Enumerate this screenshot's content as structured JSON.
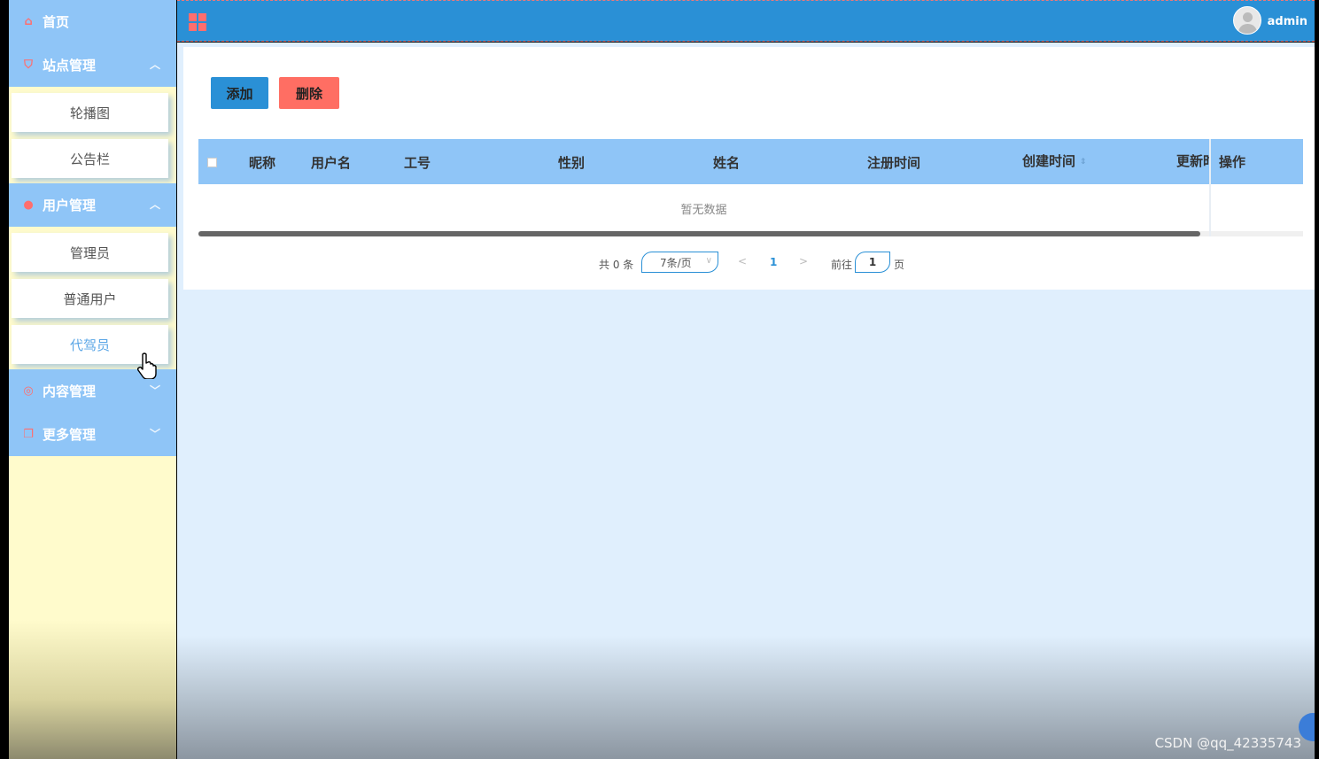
{
  "sidebar": {
    "items": [
      {
        "label": "首页",
        "icon": "home-icon",
        "type": "top"
      },
      {
        "label": "站点管理",
        "icon": "bookmark-icon",
        "type": "group",
        "expanded": true,
        "children": [
          {
            "label": "轮播图"
          },
          {
            "label": "公告栏"
          }
        ]
      },
      {
        "label": "用户管理",
        "icon": "user-icon",
        "type": "group",
        "expanded": true,
        "children": [
          {
            "label": "管理员"
          },
          {
            "label": "普通用户"
          },
          {
            "label": "代驾员",
            "active": true
          }
        ]
      },
      {
        "label": "内容管理",
        "icon": "chat-icon",
        "type": "group",
        "expanded": false
      },
      {
        "label": "更多管理",
        "icon": "copy-icon",
        "type": "group",
        "expanded": false
      }
    ]
  },
  "header": {
    "username": "admin"
  },
  "toolbar": {
    "add_label": "添加",
    "delete_label": "删除"
  },
  "table": {
    "columns": [
      "昵称",
      "用户名",
      "工号",
      "性别",
      "姓名",
      "注册时间",
      "创建时间",
      "更新时"
    ],
    "action_column": "操作",
    "empty_text": "暂无数据"
  },
  "pagination": {
    "total_text": "共 0 条",
    "page_size": "7条/页",
    "current_page": "1",
    "goto_label": "前往",
    "goto_value": "1",
    "unit_label": "页"
  },
  "watermark": "CSDN @qq_42335743",
  "colors": {
    "header": "#2a90d6",
    "menu": "#8fc5f7",
    "danger": "#ff6e63",
    "sidebar_bg": "#fffbcc"
  }
}
